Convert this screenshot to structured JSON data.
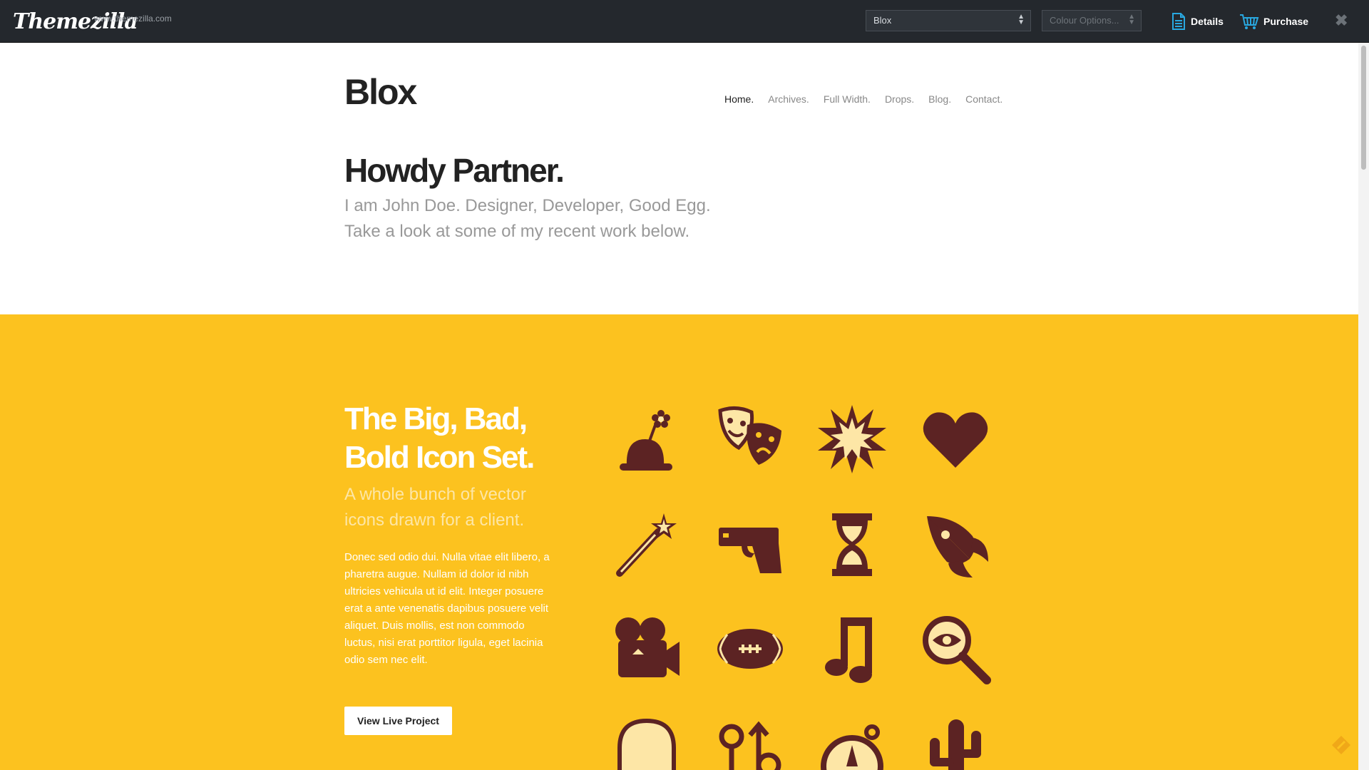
{
  "topbar": {
    "logo_text": "Themezilla",
    "logo_url": "www.themezilla.com",
    "theme_select": "Blox",
    "colour_select_placeholder": "Colour Options...",
    "details_label": "Details",
    "purchase_label": "Purchase",
    "close_symbol": "✖"
  },
  "header": {
    "site_title": "Blox",
    "nav": [
      "Home.",
      "Archives.",
      "Full Width.",
      "Drops.",
      "Blog.",
      "Contact."
    ]
  },
  "hero": {
    "title": "Howdy Partner.",
    "line1": "I am John Doe. Designer, Developer, Good Egg.",
    "line2": "Take a look at some of my recent work below."
  },
  "feature": {
    "title_line1": "The Big, Bad,",
    "title_line2": "Bold Icon Set.",
    "sub_line1": "A whole bunch of vector",
    "sub_line2": "icons drawn for a client.",
    "body": "Donec sed odio dui. Nulla vitae elit libero, a pharetra augue. Nullam id dolor id nibh ultricies vehicula ut id elit. Integer posuere erat a ante venenatis dapibus posuere velit aliquet. Duis mollis, est non commodo luctus, nisi erat porttitor ligula, eget lacinia odio sem nec elit.",
    "button_label": "View Live Project",
    "icons": [
      "bomb-flower-icon",
      "theater-masks-icon",
      "explosion-icon",
      "heart-icon",
      "magic-wand-icon",
      "pistol-icon",
      "hourglass-icon",
      "rocket-icon",
      "movie-camera-icon",
      "football-icon",
      "music-note-icon",
      "magnifier-eye-icon",
      "skull-icon",
      "gender-symbols-icon",
      "compass-icon",
      "cactus-icon"
    ]
  },
  "colors": {
    "topbar": "#24282d",
    "feature_bg": "#fcc21f",
    "icon_color": "#5c2323",
    "accent": "#29a8e0"
  }
}
